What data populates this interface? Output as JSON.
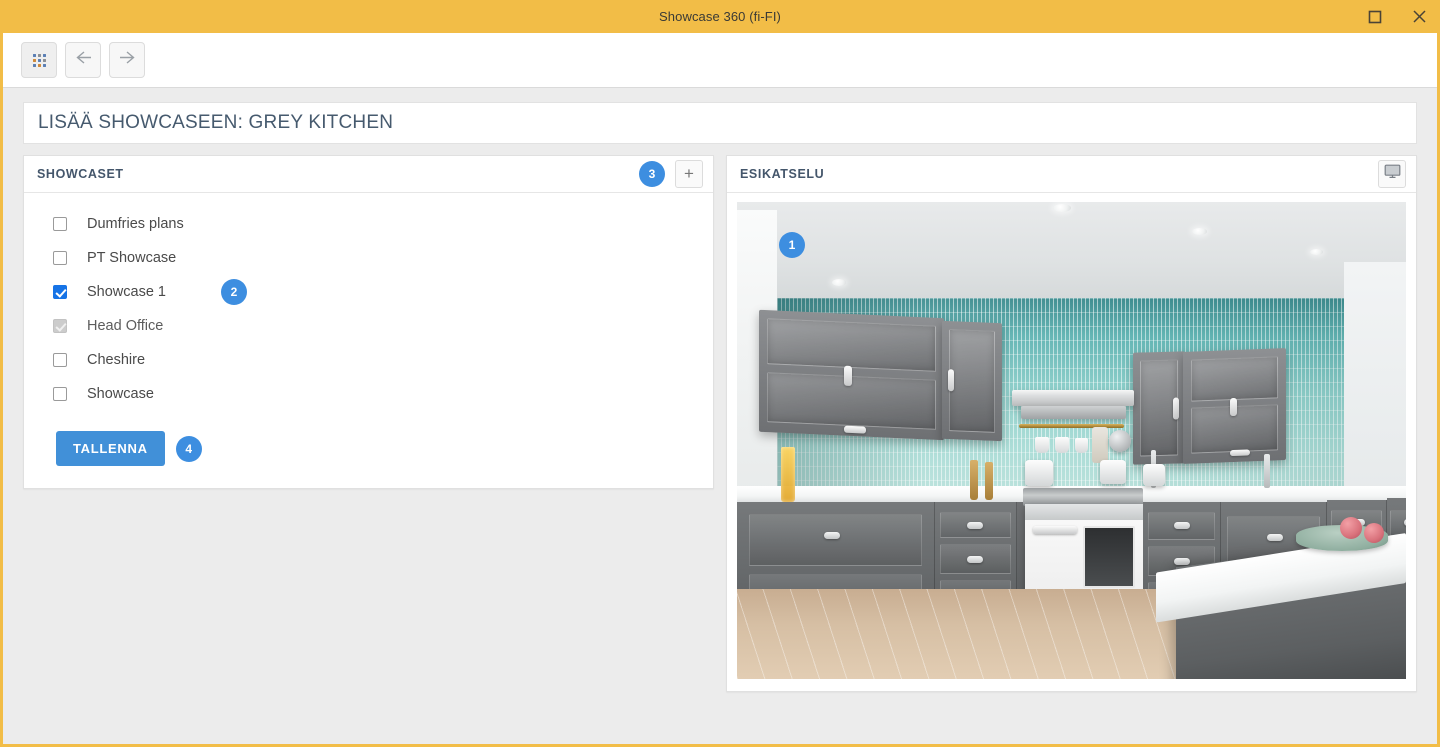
{
  "titlebar": {
    "title": "Showcase 360 (fi-FI)",
    "maximize_icon": "maximize-icon",
    "close_icon": "close-icon"
  },
  "toolbar": {
    "grid_icon": "grid-icon",
    "back_icon": "arrow-left-icon",
    "forward_icon": "arrow-right-icon"
  },
  "page": {
    "title": "LISÄÄ SHOWCASEEN: GREY KITCHEN"
  },
  "showcases_panel": {
    "heading": "SHOWCASET",
    "badge": "3",
    "add_label": "+",
    "items": [
      {
        "label": "Dumfries plans",
        "checked": false,
        "disabled": false,
        "badge": null
      },
      {
        "label": "PT Showcase",
        "checked": false,
        "disabled": false,
        "badge": null
      },
      {
        "label": "Showcase 1",
        "checked": true,
        "disabled": false,
        "badge": "2"
      },
      {
        "label": "Head Office",
        "checked": true,
        "disabled": true,
        "badge": null
      },
      {
        "label": "Cheshire",
        "checked": false,
        "disabled": false,
        "badge": null
      },
      {
        "label": "Showcase",
        "checked": false,
        "disabled": false,
        "badge": null
      }
    ],
    "save_label": "TALLENNA",
    "save_badge": "4"
  },
  "preview_panel": {
    "heading": "ESIKATSELU",
    "display_icon": "monitor-icon",
    "image_badge": "1",
    "image_alt": "Grey kitchen 360 render with teal tile splashback"
  },
  "colors": {
    "titlebar": "#f2bd47",
    "accent_blue": "#3d8ee0",
    "checkbox_blue": "#1673e6",
    "button_blue": "#4190d8",
    "heading_text": "#44566b",
    "page_bg": "#ececec"
  }
}
